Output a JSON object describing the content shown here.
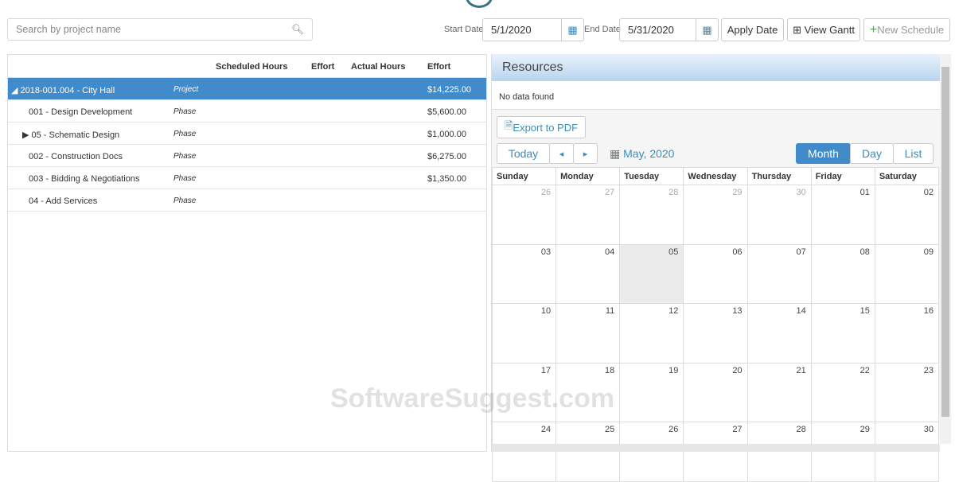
{
  "toolbar": {
    "search_placeholder": "Search by project name",
    "start_label": "Start Date",
    "start_value": "5/1/2020",
    "end_label": "End Date",
    "end_value": "5/31/2020",
    "apply": "Apply Date",
    "gantt": "View Gantt",
    "new_schedule": "New Schedule"
  },
  "grid": {
    "headers": [
      "Scheduled Hours",
      "Effort",
      "Actual Hours",
      "Effort"
    ],
    "rows": [
      {
        "name": "◢ 2018-001.004 - City Hall",
        "type": "Project",
        "effort": "$14,225.00"
      },
      {
        "name": "001 - Design Development",
        "type": "Phase",
        "effort": "$5,600.00"
      },
      {
        "name": "▶ 05 - Schematic Design",
        "type": "Phase",
        "effort": "$1,000.00"
      },
      {
        "name": "002 - Construction Docs",
        "type": "Phase",
        "effort": "$6,275.00"
      },
      {
        "name": "003 - Bidding & Negotiations",
        "type": "Phase",
        "effort": "$1,350.00"
      },
      {
        "name": "04 - Add Services",
        "type": "Phase",
        "effort": ""
      }
    ]
  },
  "resources": {
    "title": "Resources",
    "empty": "No data found"
  },
  "calendar": {
    "export": "Export to PDF",
    "today": "Today",
    "prev": "◂",
    "next": "▸",
    "month_label": "May, 2020",
    "views": [
      "Month",
      "Day",
      "List"
    ],
    "days": [
      "Sunday",
      "Monday",
      "Tuesday",
      "Wednesday",
      "Thursday",
      "Friday",
      "Saturday"
    ],
    "weeks": [
      [
        "26",
        "27",
        "28",
        "29",
        "30",
        "01",
        "02"
      ],
      [
        "03",
        "04",
        "05",
        "06",
        "07",
        "08",
        "09"
      ],
      [
        "10",
        "11",
        "12",
        "13",
        "14",
        "15",
        "16"
      ],
      [
        "17",
        "18",
        "19",
        "20",
        "21",
        "22",
        "23"
      ],
      [
        "24",
        "25",
        "26",
        "27",
        "28",
        "29",
        "30"
      ]
    ]
  },
  "watermark": "SoftwareSuggest.com"
}
